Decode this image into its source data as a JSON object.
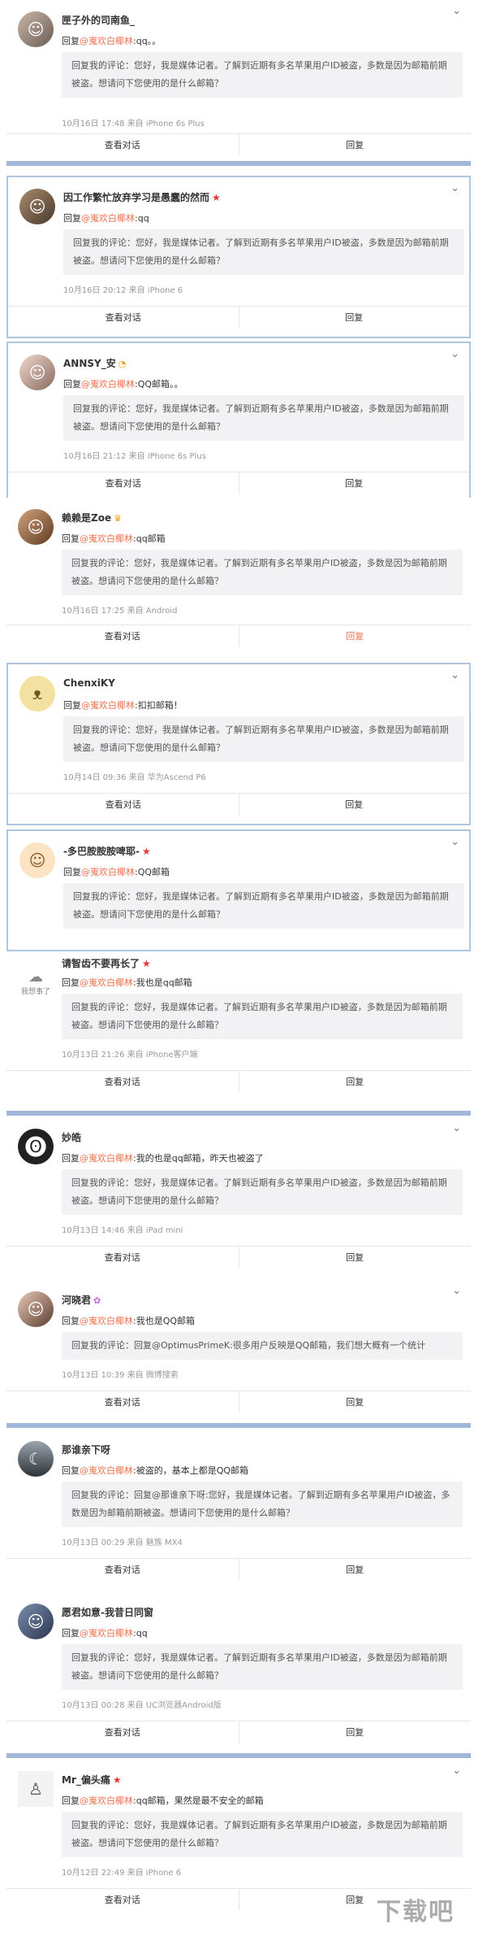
{
  "labels": {
    "view_conversation": "查看对话",
    "reply": "回复"
  },
  "reply_prefix": "回复",
  "mention": "@嵬欢白椰林",
  "chevron": "⌄",
  "star": "★",
  "quote_standard": "回复我的评论：您好，我是媒体记者。了解到近期有多名苹果用户ID被盗，多数是因为邮箱前期被盗。想请问下您使用的是什么邮箱？",
  "comments": [
    {
      "name": "匣子外的司南鱼_",
      "content": ":qq。。",
      "meta": "10月16日 17:48 来自 iPhone 6s Plus"
    },
    {
      "name": "因工作繁忙放弃学习是愚蠢的然而",
      "content": ":qq",
      "meta": "10月16日 20:12 来自 iPhone 6"
    },
    {
      "name": "ANNSY_安",
      "content": ":QQ邮箱。。",
      "meta": "10月16日 21:12 来自 iPhone 6s Plus"
    },
    {
      "name": "赖赖是Zoe",
      "content": ":qq邮箱",
      "meta": "10月16日 17:25 来自 Android"
    },
    {
      "name": "ChenxiKY",
      "content": ":扣扣邮箱！",
      "meta": "10月14日 09:36 来自 华为Ascend P6"
    },
    {
      "name": "-多巴胺胺胺啤耶-",
      "content": ":QQ邮箱",
      "meta": ""
    },
    {
      "name": "请智齿不要再长了",
      "content": ":我也是qq邮箱",
      "meta": "10月13日 21:26 来自 iPhone客户端"
    },
    {
      "name": "妙皓",
      "content": ":我的也是qq邮箱，昨天也被盗了",
      "meta": "10月13日 14:46 来自 iPad mini"
    },
    {
      "name": "河晓君",
      "content": ":我也是QQ邮箱",
      "quote": "回复我的评论：回复@OptimusPrimeK:很多用户反映是QQ邮箱，我们想大概有一个统计",
      "meta": "10月13日 10:39 来自 微博搜索"
    },
    {
      "name": "那谁亲下呀",
      "content": ":被盗的，基本上都是QQ邮箱",
      "quote": "回复我的评论：回复@那谁亲下呀:您好，我是媒体记者。了解到近期有多名苹果用户ID被盗，多数是因为邮箱前期被盗。想请问下您使用的是什么邮箱？",
      "meta": "10月13日 00:29 来自 魅族 MX4"
    },
    {
      "name": "愿君如意-我昔日同窗",
      "content": ":qq",
      "meta": "10月13日 00:28 来自 UC浏览器Android版"
    },
    {
      "name": "Mr_偏头痛",
      "content": ":qq邮箱，果然是最不安全的邮箱",
      "meta": "10月12日 22:49 来自 iPhone 6"
    }
  ],
  "avatar_labels": {
    "c6": "我想事了"
  },
  "watermark": "下载吧",
  "colors": {
    "accent": "#eb7350",
    "separator": "#9fb8d8",
    "star": "#e23a2e"
  }
}
